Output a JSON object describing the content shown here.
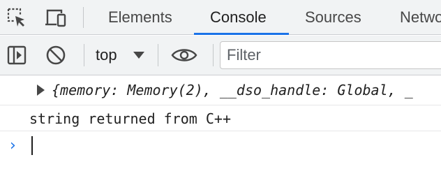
{
  "tabbar": {
    "icons": [
      "inspect-element-icon",
      "device-toolbar-icon"
    ],
    "tabs": [
      "Elements",
      "Console",
      "Sources",
      "Network"
    ],
    "active_tab": "Console"
  },
  "toolbar": {
    "icons": [
      "show-console-sidebar-icon",
      "clear-console-icon",
      "live-expression-eye-icon"
    ],
    "context": "top",
    "filter_placeholder": "Filter",
    "filter_value": ""
  },
  "console": {
    "messages": [
      {
        "type": "object",
        "text": "{memory: Memory(2), __dso_handle: Global, _"
      },
      {
        "type": "string",
        "text": "string returned from C++"
      }
    ],
    "prompt_symbol": "›",
    "input_value": ""
  },
  "colors": {
    "accent": "#1a73e8",
    "toolbar_bg": "#f1f3f4",
    "divider": "#cbcdd1",
    "text": "#1f1f1f"
  }
}
